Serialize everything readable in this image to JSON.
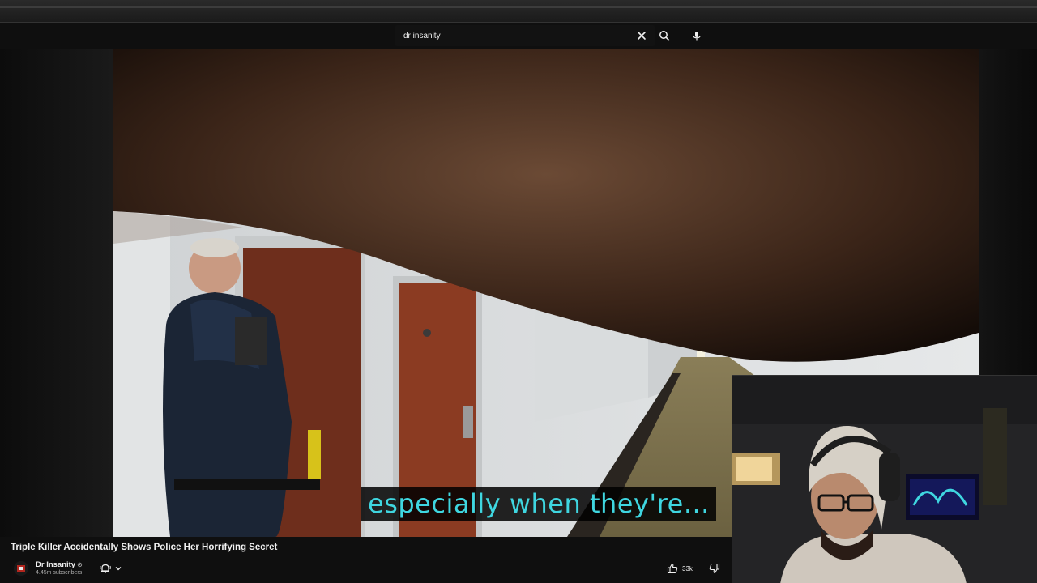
{
  "search": {
    "query": "dr insanity",
    "clear_icon": "close-icon",
    "search_icon": "search-icon",
    "mic_icon": "microphone-icon"
  },
  "video": {
    "caption": "especially when they're...",
    "caption_color": "#3fd6e0"
  },
  "info": {
    "title": "Triple Killer Accidentally Shows Police Her Horrifying Secret",
    "channel_name": "Dr Insanity",
    "verified_mark": "⊙",
    "subscribers": "4.45m subscribers",
    "like_count": "33k"
  },
  "colors": {
    "background": "#0f0f0f",
    "text": "#f1f1f1",
    "muted": "#aaaaaa"
  }
}
